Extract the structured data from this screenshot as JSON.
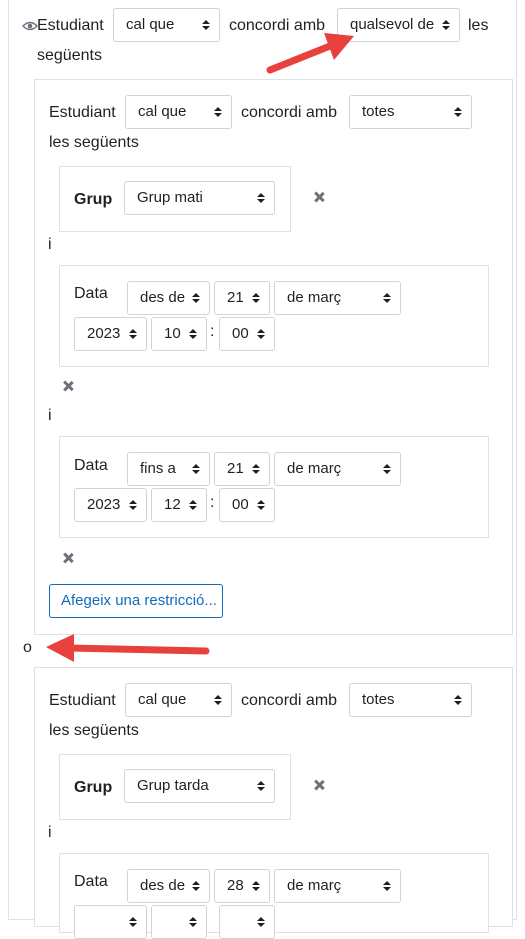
{
  "root": {
    "label": "Estudiant",
    "must": "cal que",
    "concordi": "concordi amb",
    "match": "qualsevol de",
    "les": "les",
    "seguents": "següents"
  },
  "set1": {
    "label": "Estudiant",
    "must": "cal que",
    "concordi": "concordi amb",
    "match": "totes",
    "seguents": "les següents",
    "grup_label": "Grup",
    "grup_value": "Grup mati",
    "and1": "i",
    "date1": {
      "label": "Data",
      "direction": "des de",
      "day": "21",
      "month": "de març",
      "year": "2023",
      "hour": "10",
      "minute": "00"
    },
    "and2": "i",
    "date2": {
      "label": "Data",
      "direction": "fins a",
      "day": "21",
      "month": "de març",
      "year": "2023",
      "hour": "12",
      "minute": "00"
    },
    "add_button": "Afegeix una restricció..."
  },
  "or_label": "o",
  "set2": {
    "label": "Estudiant",
    "must": "cal que",
    "concordi": "concordi amb",
    "match": "totes",
    "seguents": "les següents",
    "grup_label": "Grup",
    "grup_value": "Grup tarda",
    "and1": "i",
    "date1": {
      "label": "Data",
      "direction": "des de",
      "day": "28",
      "month": "de març"
    }
  },
  "colors": {
    "arrow": "#e8403c",
    "link": "#0f6cbf",
    "border": "#dee2e6"
  },
  "icons": {
    "eye": "eye-icon",
    "close": "close-icon"
  }
}
